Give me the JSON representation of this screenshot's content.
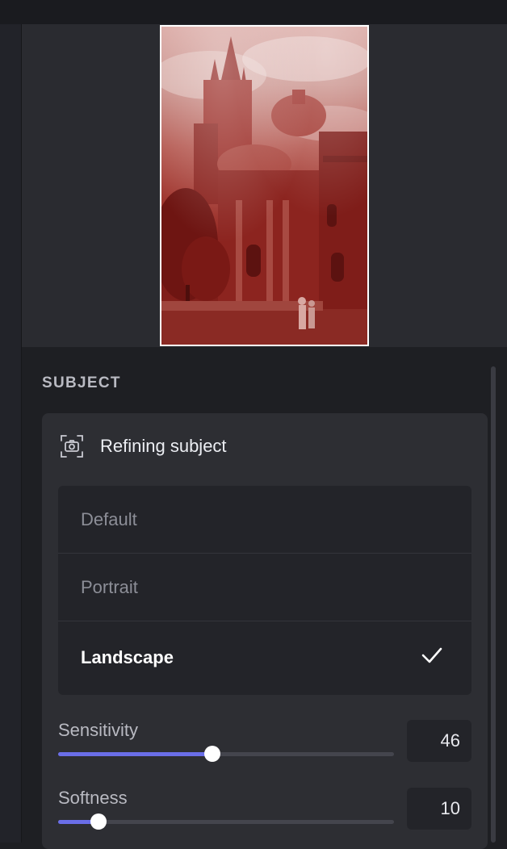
{
  "section": {
    "title": "SUBJECT"
  },
  "card": {
    "header_label": "Refining subject",
    "header_icon": "subject-camera-icon"
  },
  "options": [
    {
      "label": "Default",
      "selected": false
    },
    {
      "label": "Portrait",
      "selected": false
    },
    {
      "label": "Landscape",
      "selected": true
    }
  ],
  "sliders": {
    "sensitivity": {
      "label": "Sensitivity",
      "value": "46",
      "fraction": 0.46
    },
    "softness": {
      "label": "Softness",
      "value": "10",
      "fraction": 0.12
    }
  },
  "colors": {
    "accent": "#6a6ee8",
    "overlay": "#8b1a16",
    "background": "#1e1f23",
    "card": "#2d2e33"
  }
}
